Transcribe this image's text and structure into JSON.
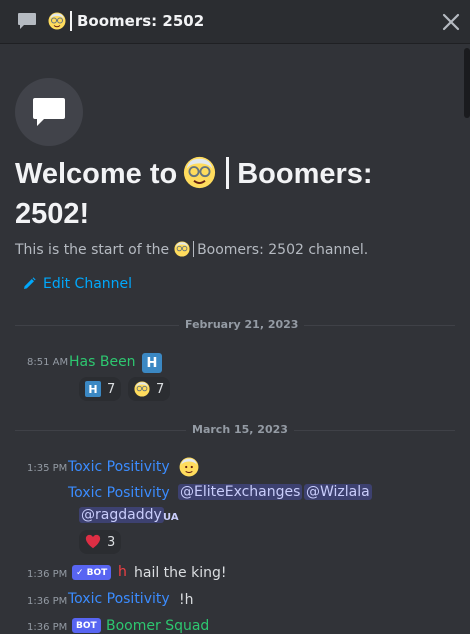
{
  "header": {
    "title": "Boomers: 2502",
    "icon": "chat-bubble-icon",
    "close_icon": "close-icon"
  },
  "welcome": {
    "prefix": "Welcome to",
    "name_line1": "Boomers:",
    "name_line2": "2502!",
    "subtitle_prefix": "This is the start of the",
    "subtitle_channel": "Boomers: 2502 channel.",
    "edit_label": "Edit Channel"
  },
  "dividers": {
    "feb": "February 21, 2023",
    "mar": "March 15, 2023"
  },
  "messages": {
    "m1": {
      "time": "8:51 AM",
      "author": "Has Been",
      "badge": "H",
      "reactions": [
        {
          "emoji": "H",
          "count": "7"
        },
        {
          "emoji": "older-man",
          "count": "7"
        }
      ]
    },
    "m2": {
      "time": "1:35 PM",
      "author": "Toxic Positivity",
      "line_author": "Toxic Positivity",
      "mentions": [
        "@EliteExchanges",
        "@Wizlala",
        "@ragdaddy"
      ],
      "ua": "UA",
      "reactions": [
        {
          "emoji": "heart",
          "count": "3"
        }
      ]
    },
    "m3": {
      "time": "1:36 PM",
      "bot_tag": "✓ BOT",
      "author": "h",
      "text": "hail the king!"
    },
    "m4": {
      "time": "1:36 PM",
      "author": "Toxic Positivity",
      "text": "!h"
    },
    "m5": {
      "time": "1:36 PM",
      "bot_tag": "BOT",
      "author": "Boomer Squad"
    }
  },
  "colors": {
    "background": "#313338",
    "header": "#2b2d31",
    "green_name": "#2dc770",
    "blue_name": "#3b8cff",
    "link": "#00a8fc",
    "bot_badge": "#5865f2"
  }
}
